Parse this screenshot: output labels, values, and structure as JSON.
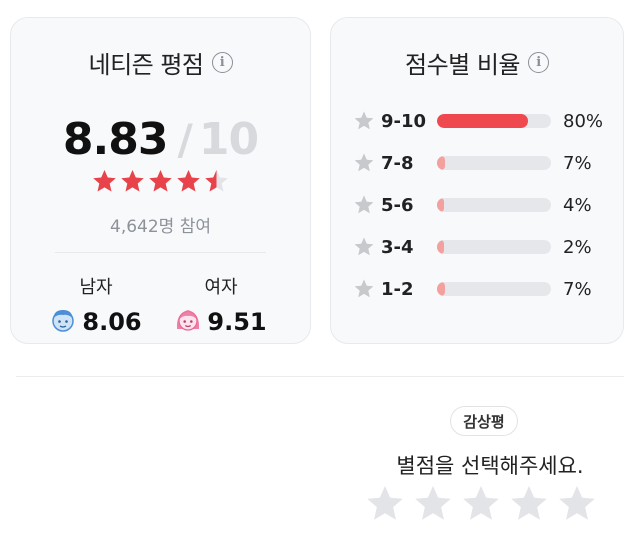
{
  "netizen": {
    "title": "네티즌 평점",
    "score": "8.83",
    "separator": "/",
    "max": "10",
    "stars_filled": 4.5,
    "participants": "4,642명 참여",
    "male": {
      "label": "남자",
      "score": "8.06"
    },
    "female": {
      "label": "여자",
      "score": "9.51"
    }
  },
  "distribution": {
    "title": "점수별 비율",
    "rows": [
      {
        "label": "9-10",
        "percent": "80%",
        "fraction": 0.8,
        "color": "#f0484f"
      },
      {
        "label": "7-8",
        "percent": "7%",
        "fraction": 0.07,
        "color": "#f3a19f"
      },
      {
        "label": "5-6",
        "percent": "4%",
        "fraction": 0.04,
        "color": "#f3a19f"
      },
      {
        "label": "3-4",
        "percent": "2%",
        "fraction": 0.02,
        "color": "#f3a19f"
      },
      {
        "label": "1-2",
        "percent": "7%",
        "fraction": 0.07,
        "color": "#f3a19f"
      }
    ]
  },
  "review": {
    "badge": "감상평",
    "prompt": "별점을 선택해주세요.",
    "stars_count": 5
  },
  "colors": {
    "star_red": "#e8434b",
    "star_gray": "#c7c9cd",
    "empty_star": "#e3e4e7"
  },
  "icons": {
    "info": "info-icon",
    "star": "star-icon",
    "male_face": "male-face-icon",
    "female_face": "female-face-icon"
  }
}
